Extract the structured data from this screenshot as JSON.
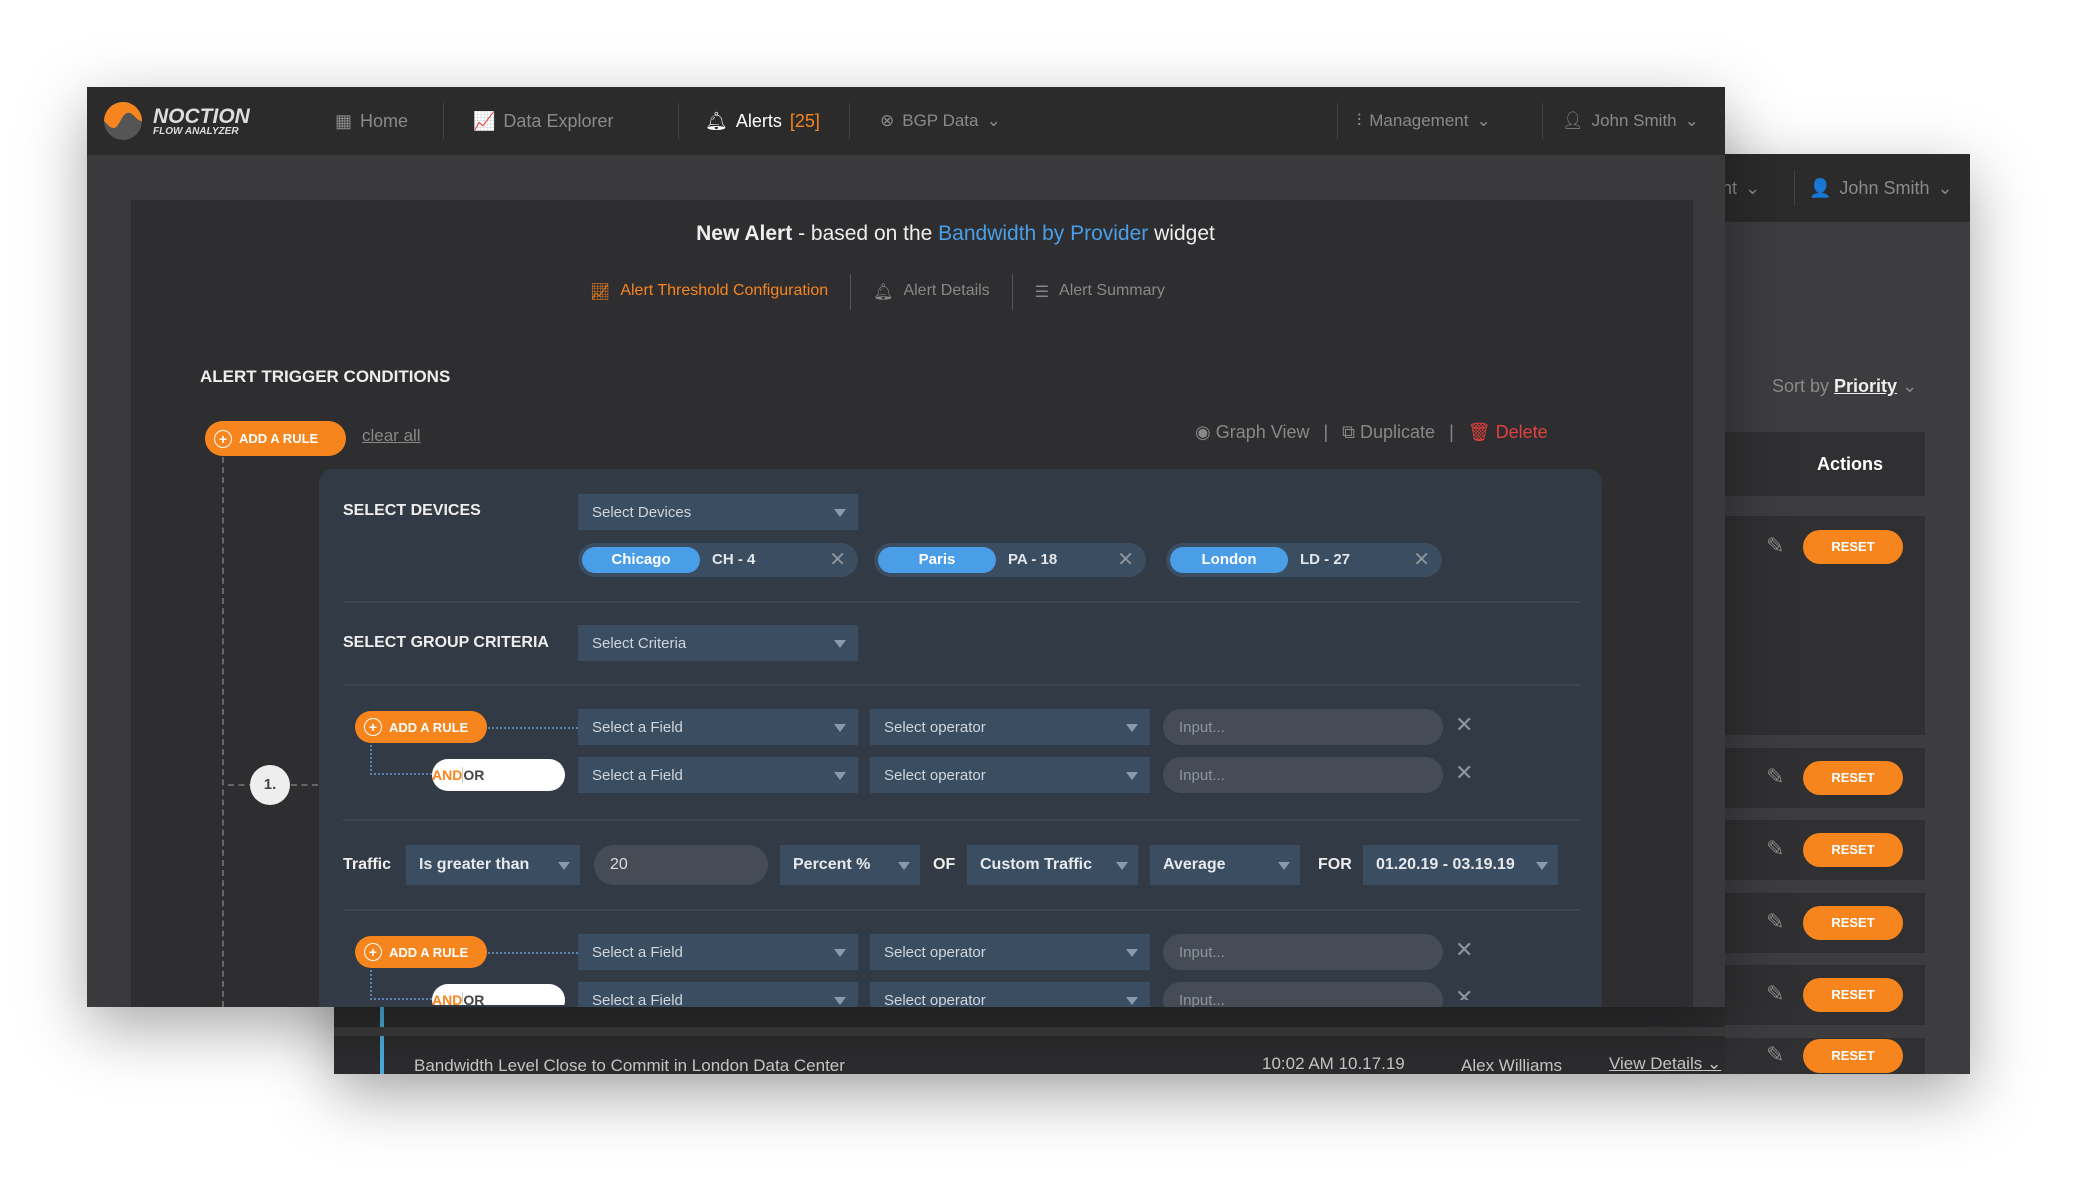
{
  "colors": {
    "accent": "#f7851e",
    "link": "#4a9ee8",
    "danger": "#e0403f"
  },
  "nav": {
    "brand": "NOCTION",
    "brand_sub": "FLOW ANALYZER",
    "home": "Home",
    "data_explorer": "Data Explorer",
    "alerts": "Alerts",
    "alerts_count": "[25]",
    "bgp": "BGP Data",
    "management": "Management",
    "user": "John Smith"
  },
  "back": {
    "nav_partial": "nt",
    "user": "John Smith",
    "sort_by": "Sort by",
    "sort_value": "Priority",
    "actions_header": "Actions",
    "reset_label": "RESET",
    "row": {
      "title": "Bandwidth Level Close to Commit in London Data Center",
      "time": "10:02 AM 10.17.19",
      "owner": "Alex Williams",
      "details": "View Details"
    }
  },
  "header": {
    "title_bold": "New Alert",
    "title_mid": " - based on the ",
    "title_link": "Bandwidth by Provider",
    "title_end": " widget"
  },
  "tabs": [
    {
      "label": "Alert Threshold Configuration",
      "active": true
    },
    {
      "label": "Alert Details"
    },
    {
      "label": "Alert Summary"
    }
  ],
  "section_title": "ALERT TRIGGER CONDITIONS",
  "toolbar": {
    "add_rule": "ADD A RULE",
    "clear_all": "clear all",
    "graph_view": "Graph View",
    "duplicate": "Duplicate",
    "delete": "Delete"
  },
  "devices": {
    "label": "SELECT DEVICES",
    "placeholder": "Select Devices",
    "chips": [
      {
        "city": "Chicago",
        "code": "CH - 4"
      },
      {
        "city": "Paris",
        "code": "PA - 18"
      },
      {
        "city": "London",
        "code": "LD - 27"
      }
    ]
  },
  "group": {
    "label": "SELECT GROUP CRITERIA",
    "placeholder": "Select Criteria"
  },
  "rule": {
    "field": "Select a Field",
    "operator": "Select operator",
    "input": "Input...",
    "and": "AND",
    "or": "OR"
  },
  "step": "1.",
  "traffic": {
    "label": "Traffic",
    "condition": "Is greater than",
    "value": "20",
    "unit": "Percent %",
    "of": "OF",
    "source": "Custom Traffic",
    "agg": "Average",
    "for": "FOR",
    "range": "01.20.19 - 03.19.19"
  }
}
